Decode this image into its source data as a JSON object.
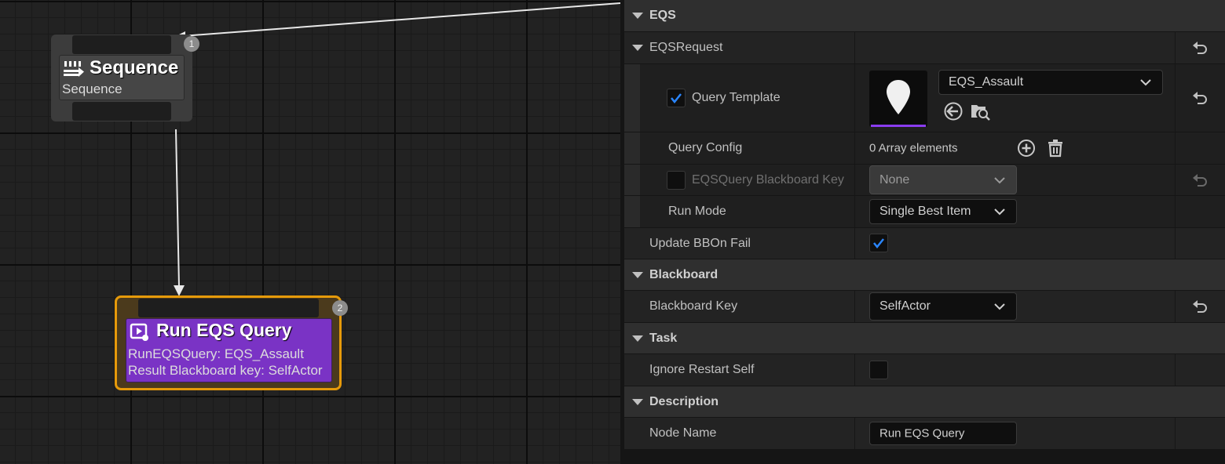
{
  "graph": {
    "sequence_node": {
      "title": "Sequence",
      "subtitle": "Sequence",
      "badge": "1",
      "icon": "sequence-icon"
    },
    "eqs_node": {
      "title": "Run EQS Query",
      "line1": "RunEQSQuery: EQS_Assault",
      "line2": "Result Blackboard key: SelfActor",
      "badge": "2",
      "icon": "run-eqs-icon",
      "accent": "#7a33c5",
      "border": "#e69a0a"
    }
  },
  "details": {
    "eqs_category": "EQS",
    "eqs_request": "EQSRequest",
    "query_template": {
      "label": "Query Template",
      "checked": true,
      "asset": "EQS_Assault",
      "thumbnail_icon": "map-pin-icon",
      "browse_icon": "arrow-left-circle-icon",
      "find_icon": "folder-search-icon"
    },
    "query_config": {
      "label": "Query Config",
      "value": "0 Array elements",
      "add_icon": "plus-circle-icon",
      "delete_icon": "trash-icon"
    },
    "eqs_query_bb_key": {
      "label": "EQSQuery Blackboard Key",
      "checked": false,
      "value": "None"
    },
    "run_mode": {
      "label": "Run Mode",
      "value": "Single Best Item"
    },
    "update_bb_on_fail": {
      "label": "Update BBOn Fail",
      "checked": true
    },
    "blackboard_category": "Blackboard",
    "blackboard_key": {
      "label": "Blackboard Key",
      "value": "SelfActor"
    },
    "task_category": "Task",
    "ignore_restart_self": {
      "label": "Ignore Restart Self",
      "checked": false
    },
    "description_category": "Description",
    "node_name": {
      "label": "Node Name",
      "value": "Run EQS Query"
    }
  },
  "colors": {
    "check": "#2a86ff",
    "selection_underline": "#8a3cf0"
  }
}
